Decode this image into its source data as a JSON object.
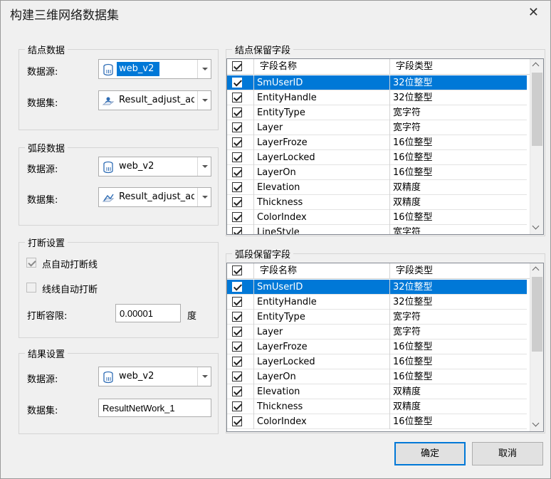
{
  "window": {
    "title": "构建三维网络数据集"
  },
  "node_data": {
    "label": "结点数据",
    "datasource_label": "数据源:",
    "datasource_value": "web_v2",
    "dataset_label": "数据集:",
    "dataset_value": "Result_adjust_adj"
  },
  "arc_data": {
    "label": "弧段数据",
    "datasource_label": "数据源:",
    "datasource_value": "web_v2",
    "dataset_label": "数据集:",
    "dataset_value": "Result_adjust_adju"
  },
  "break_settings": {
    "label": "打断设置",
    "auto_break_point_label": "点自动打断线",
    "auto_break_point_checked": true,
    "auto_break_line_label": "线线自动打断",
    "auto_break_line_checked": false,
    "tolerance_label": "打断容限:",
    "tolerance_value": "0.00001",
    "tolerance_unit": "度"
  },
  "result_settings": {
    "label": "结果设置",
    "datasource_label": "数据源:",
    "datasource_value": "web_v2",
    "dataset_label": "数据集:",
    "dataset_value": "ResultNetWork_1"
  },
  "node_fields": {
    "label": "结点保留字段",
    "col_name": "字段名称",
    "col_type": "字段类型",
    "rows": [
      {
        "name": "SmUserID",
        "type": "32位整型"
      },
      {
        "name": "EntityHandle",
        "type": "32位整型"
      },
      {
        "name": "EntityType",
        "type": "宽字符"
      },
      {
        "name": "Layer",
        "type": "宽字符"
      },
      {
        "name": "LayerFroze",
        "type": "16位整型"
      },
      {
        "name": "LayerLocked",
        "type": "16位整型"
      },
      {
        "name": "LayerOn",
        "type": "16位整型"
      },
      {
        "name": "Elevation",
        "type": "双精度"
      },
      {
        "name": "Thickness",
        "type": "双精度"
      },
      {
        "name": "ColorIndex",
        "type": "16位整型"
      },
      {
        "name": "LineStyle",
        "type": "宽字符"
      }
    ]
  },
  "arc_fields": {
    "label": "弧段保留字段",
    "col_name": "字段名称",
    "col_type": "字段类型",
    "rows": [
      {
        "name": "SmUserID",
        "type": "32位整型"
      },
      {
        "name": "EntityHandle",
        "type": "32位整型"
      },
      {
        "name": "EntityType",
        "type": "宽字符"
      },
      {
        "name": "Layer",
        "type": "宽字符"
      },
      {
        "name": "LayerFroze",
        "type": "16位整型"
      },
      {
        "name": "LayerLocked",
        "type": "16位整型"
      },
      {
        "name": "LayerOn",
        "type": "16位整型"
      },
      {
        "name": "Elevation",
        "type": "双精度"
      },
      {
        "name": "Thickness",
        "type": "双精度"
      },
      {
        "name": "ColorIndex",
        "type": "16位整型"
      }
    ]
  },
  "buttons": {
    "ok": "确定",
    "cancel": "取消"
  },
  "colors": {
    "selection": "#0078d7",
    "background": "#f0f0f0",
    "border": "#adadad"
  },
  "icons": {
    "datasource": "database-icon",
    "point_dataset": "point-dataset-icon",
    "line_dataset": "line-dataset-icon",
    "close": "close-icon"
  }
}
